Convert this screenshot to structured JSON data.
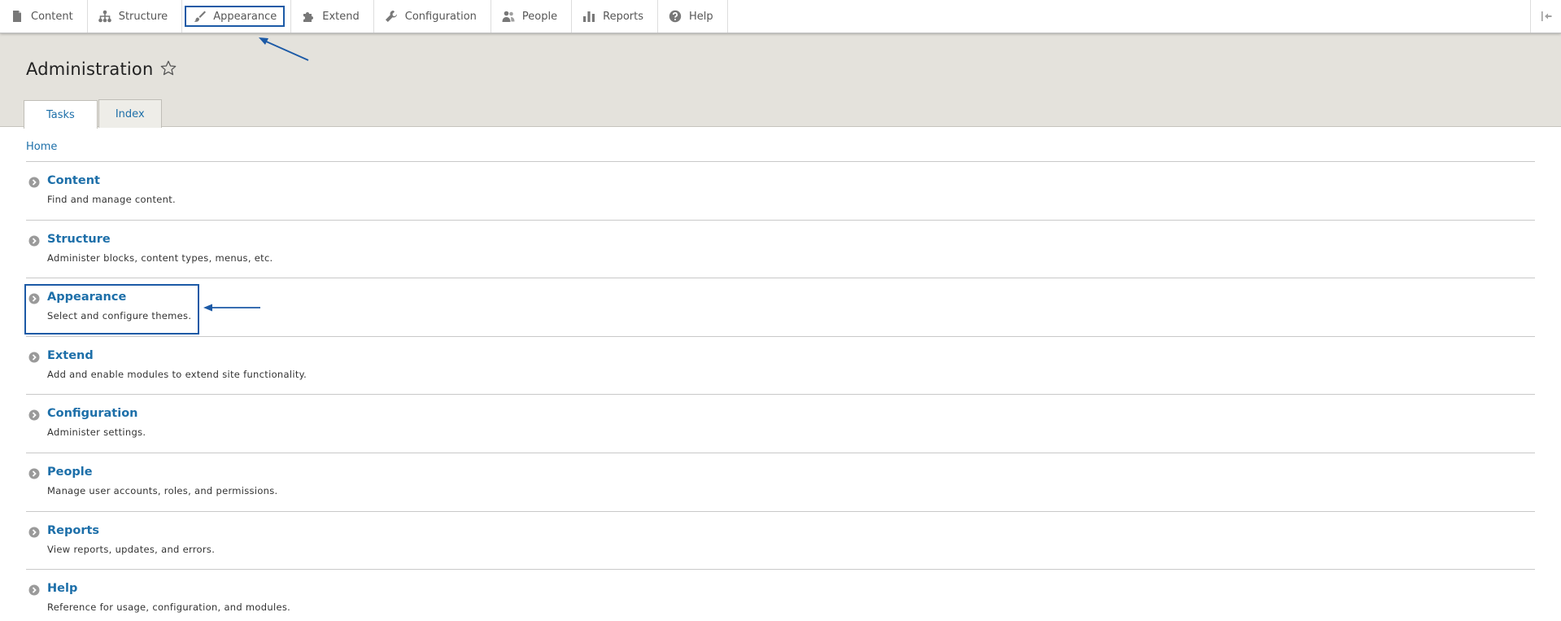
{
  "toolbar": {
    "items": [
      {
        "label": "Content",
        "icon": "file-icon"
      },
      {
        "label": "Structure",
        "icon": "sitemap-icon"
      },
      {
        "label": "Appearance",
        "icon": "paintbrush-icon"
      },
      {
        "label": "Extend",
        "icon": "puzzle-icon"
      },
      {
        "label": "Configuration",
        "icon": "wrench-icon"
      },
      {
        "label": "People",
        "icon": "people-icon"
      },
      {
        "label": "Reports",
        "icon": "bar-chart-icon"
      },
      {
        "label": "Help",
        "icon": "help-icon"
      }
    ]
  },
  "header": {
    "title": "Administration",
    "tabs": [
      {
        "label": "Tasks",
        "active": true
      },
      {
        "label": "Index",
        "active": false
      }
    ]
  },
  "breadcrumb": "Home",
  "admin_items": [
    {
      "title": "Content",
      "description": "Find and manage content."
    },
    {
      "title": "Structure",
      "description": "Administer blocks, content types, menus, etc."
    },
    {
      "title": "Appearance",
      "description": "Select and configure themes."
    },
    {
      "title": "Extend",
      "description": "Add and enable modules to extend site functionality."
    },
    {
      "title": "Configuration",
      "description": "Administer settings."
    },
    {
      "title": "People",
      "description": "Manage user accounts, roles, and permissions."
    },
    {
      "title": "Reports",
      "description": "View reports, updates, and errors."
    },
    {
      "title": "Help",
      "description": "Reference for usage, configuration, and modules."
    }
  ],
  "colors": {
    "link": "#1d6fa9",
    "header_bg": "#e4e2dc",
    "annotation": "#1c5aa6",
    "icon": "#787878"
  }
}
